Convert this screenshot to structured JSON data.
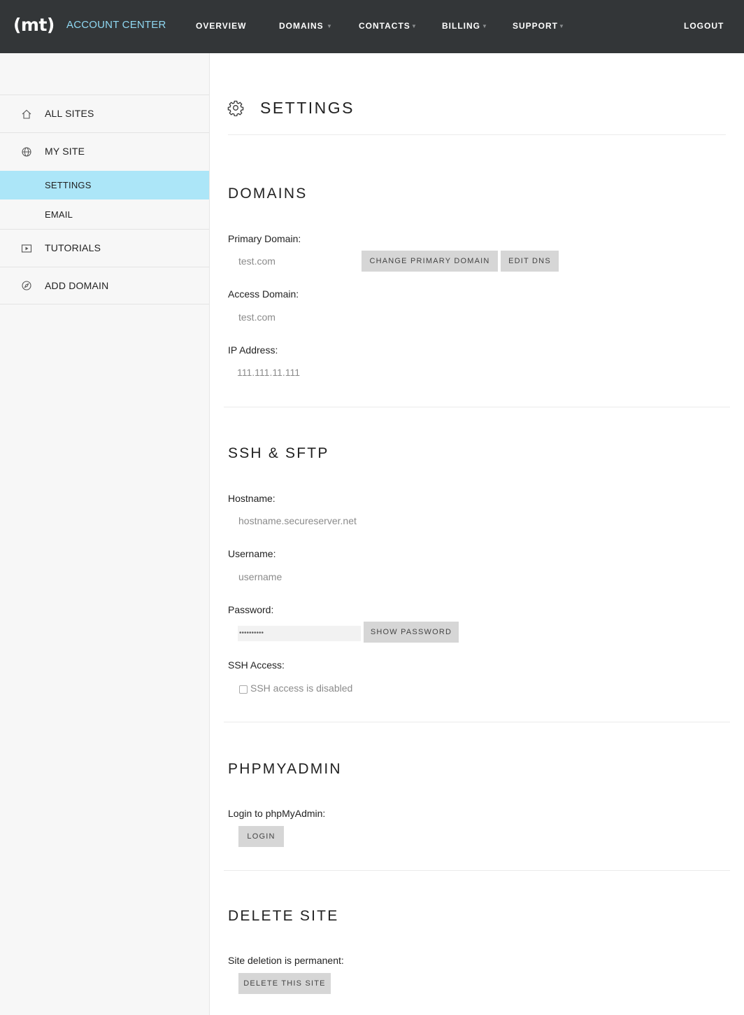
{
  "header": {
    "logo": "(mt)",
    "brand": "ACCOUNT CENTER",
    "nav": [
      "OVERVIEW",
      "DOMAINS",
      "CONTACTS",
      "BILLING",
      "SUPPORT"
    ],
    "logout": "LOGOUT"
  },
  "sidebar": {
    "items": [
      {
        "label": "ALL SITES",
        "icon": "home-icon"
      },
      {
        "label": "MY SITE",
        "icon": "globe-icon"
      },
      {
        "label": "SETTINGS",
        "active": true
      },
      {
        "label": "EMAIL"
      },
      {
        "label": "TUTORIALS",
        "icon": "play-icon"
      },
      {
        "label": "ADD DOMAIN",
        "icon": "compass-icon"
      }
    ]
  },
  "page": {
    "title": "SETTINGS",
    "icon": "gear-icon"
  },
  "domains": {
    "title": "DOMAINS",
    "primary_label": "Primary Domain:",
    "primary_value": "test.com",
    "change_primary_btn": "CHANGE PRIMARY DOMAIN",
    "edit_dns_btn": "EDIT DNS",
    "access_label": "Access Domain:",
    "access_value": "test.com",
    "ip_label": "IP Address:",
    "ip_value": "111.111.11.111"
  },
  "ssh": {
    "title": "SSH & SFTP",
    "hostname_label": "Hostname:",
    "hostname_value": "hostname.secureserver.net",
    "username_label": "Username:",
    "username_value": "username",
    "password_label": "Password:",
    "password_value": "••••••••••",
    "show_password_btn": "SHOW PASSWORD",
    "access_label": "SSH Access:",
    "access_checkbox_label": "SSH access is disabled",
    "access_enabled": false
  },
  "phpmyadmin": {
    "title": "PHPMYADMIN",
    "login_label": "Login to phpMyAdmin:",
    "login_btn": "LOGIN"
  },
  "delete": {
    "title": "DELETE SITE",
    "label": "Site deletion is permanent:",
    "btn": "DELETE THIS SITE"
  },
  "colors": {
    "topbar": "#333638",
    "brand_accent": "#8fd8f2",
    "sidebar_bg": "#f7f7f7",
    "active_item": "#ace6f8",
    "button_bg": "#d6d6d6"
  }
}
